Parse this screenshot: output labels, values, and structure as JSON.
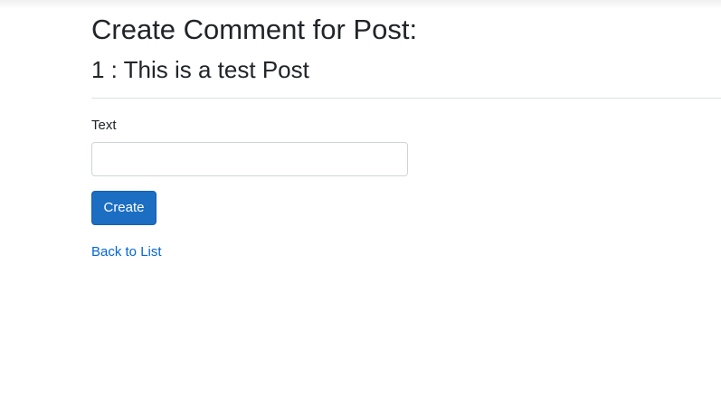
{
  "page": {
    "title": "Create Comment for Post:",
    "post_heading": "1 : This is a test Post"
  },
  "form": {
    "text_label": "Text",
    "text_value": "",
    "text_placeholder": "",
    "create_label": "Create"
  },
  "links": {
    "back_to_list": "Back to List"
  },
  "colors": {
    "primary_button": "#1b6ec2",
    "link": "#0366d6"
  }
}
